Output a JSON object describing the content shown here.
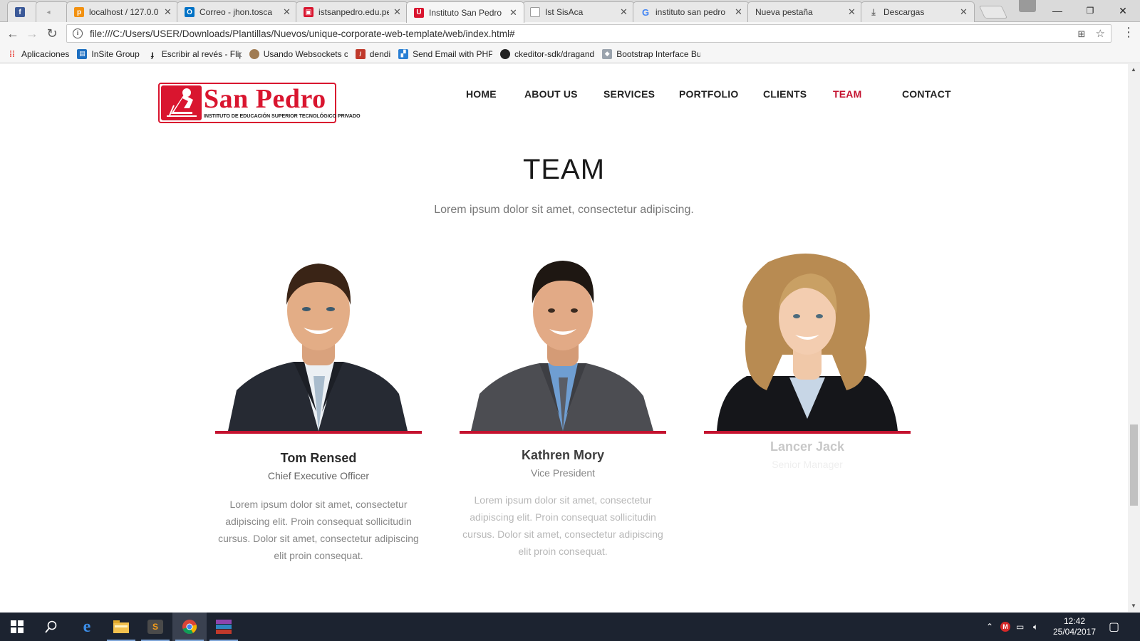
{
  "browser": {
    "tabs": [
      {
        "label": "",
        "icon": "facebook-icon",
        "color": "#3b5998"
      },
      {
        "label": "",
        "icon": "back-audio-icon",
        "color": "#999999"
      },
      {
        "label": "localhost / 127.0.0",
        "icon": "phpmyadmin-icon",
        "color": "#f29111"
      },
      {
        "label": "Correo - jhon.tosca",
        "icon": "outlook-icon",
        "color": "#0072c6"
      },
      {
        "label": "istsanpedro.edu.pe",
        "icon": "site-icon",
        "color": "#d9152f"
      },
      {
        "label": "Instituto San Pedro",
        "icon": "site-u-icon",
        "color": "#d9152f",
        "active": true
      },
      {
        "label": "Ist SisAca",
        "icon": "page-icon",
        "color": "#999999"
      },
      {
        "label": "instituto san pedro",
        "icon": "google-icon",
        "color": "#4285f4"
      },
      {
        "label": "Nueva pestaña",
        "icon": "",
        "color": ""
      },
      {
        "label": "Descargas",
        "icon": "download-icon",
        "color": "#666666"
      }
    ],
    "url": "file:///C:/Users/USER/Downloads/Plantillas/Nuevos/unique-corporate-web-template/web/index.html#",
    "bookmarks": [
      {
        "label": "Aplicaciones",
        "icon": "apps-grid-icon"
      },
      {
        "label": "InSite Group",
        "icon": "insite-icon"
      },
      {
        "label": "Escribir al revés - Flip",
        "icon": "flip-icon"
      },
      {
        "label": "Usando Websockets c",
        "icon": "user-avatar-icon"
      },
      {
        "label": "dendi",
        "icon": "dendi-icon"
      },
      {
        "label": "Send Email with PHP",
        "icon": "email-icon"
      },
      {
        "label": "ckeditor-sdk/dragand",
        "icon": "github-icon"
      },
      {
        "label": "Bootstrap Interface Bu",
        "icon": "box-icon"
      }
    ]
  },
  "site": {
    "logo": {
      "name": "San Pedro",
      "tagline": "INSTITUTO DE EDUCACIÓN SUPERIOR TECNOLÓGICO PRIVADO"
    },
    "nav": [
      "HOME",
      "ABOUT US",
      "SERVICES",
      "PORTFOLIO",
      "CLIENTS",
      "TEAM",
      "CONTACT"
    ],
    "active_nav": "TEAM",
    "accent_color": "#c4122f"
  },
  "team": {
    "title": "TEAM",
    "subtitle": "Lorem ipsum dolor sit amet, consectetur adipiscing.",
    "members": [
      {
        "name": "Tom Rensed",
        "role": "Chief Executive Officer",
        "description": "Lorem ipsum dolor sit amet, consectetur adipiscing elit. Proin consequat sollicitudin cursus. Dolor sit amet, consectetur adipiscing elit proin consequat.",
        "opacity": 1
      },
      {
        "name": "Kathren Mory",
        "role": "Vice President",
        "description": "Lorem ipsum dolor sit amet, consectetur adipiscing elit. Proin consequat sollicitudin cursus. Dolor sit amet, consectetur adipiscing elit proin consequat.",
        "opacity": 0.55
      },
      {
        "name": "Lancer Jack",
        "role": "Senior Manager",
        "description": "",
        "opacity": 0.15
      }
    ]
  },
  "taskbar": {
    "apps": [
      "start-icon",
      "search-icon",
      "edge-icon",
      "file-explorer-icon",
      "sublime-text-icon",
      "chrome-icon",
      "winrar-icon"
    ],
    "time": "12:42",
    "date": "25/04/2017"
  }
}
